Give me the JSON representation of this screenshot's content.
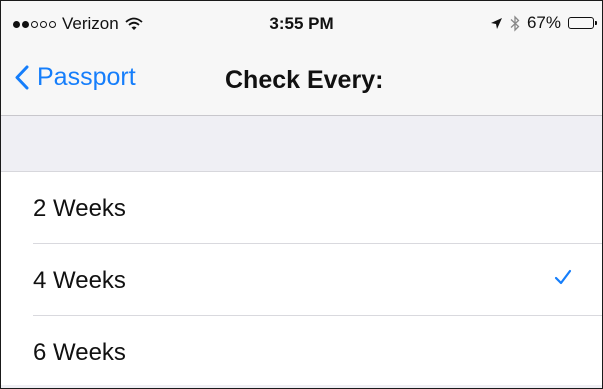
{
  "status_bar": {
    "carrier": "Verizon",
    "time": "3:55 PM",
    "battery_percent": "67%",
    "battery_level": 0.67,
    "signal_bars_filled": 2,
    "signal_bars_total": 5
  },
  "nav": {
    "back_label": "Passport",
    "title": "Check Every:"
  },
  "options": [
    {
      "label": "2 Weeks",
      "selected": false
    },
    {
      "label": "4 Weeks",
      "selected": true
    },
    {
      "label": "6 Weeks",
      "selected": false
    }
  ],
  "colors": {
    "accent": "#157efb",
    "background": "#efeff4"
  },
  "icons": {
    "back": "chevron-left-icon",
    "selected": "checkmark-icon",
    "wifi": "wifi-icon",
    "location": "location-arrow-icon",
    "bluetooth": "bluetooth-icon",
    "battery": "battery-icon"
  }
}
